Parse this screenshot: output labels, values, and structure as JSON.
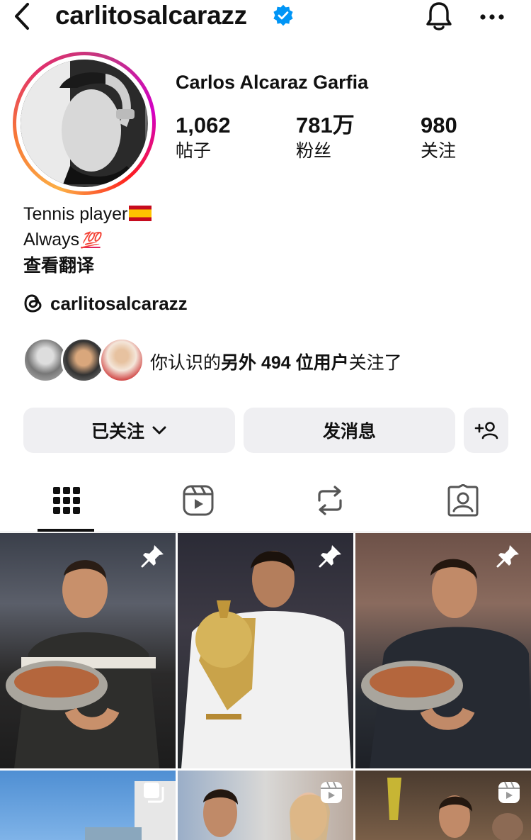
{
  "header": {
    "username": "carlitosalcarazz",
    "verified": true,
    "back_icon": "chevron-left-icon",
    "bell_icon": "bell-icon",
    "more_icon": "more-horizontal-icon"
  },
  "profile": {
    "full_name": "Carlos Alcaraz Garfia",
    "stats": [
      {
        "value": "1,062",
        "label": "帖子"
      },
      {
        "value": "781万",
        "label": "粉丝"
      },
      {
        "value": "980",
        "label": "关注"
      }
    ],
    "bio_line1": "Tennis player",
    "bio_line2": "Always",
    "bio_emoji2": "💯",
    "translate": "查看翻译",
    "threads_handle": "carlitosalcarazz"
  },
  "mutual": {
    "prefix": "你认识的",
    "bold": "另外 494 位用户",
    "suffix": "关注了"
  },
  "actions": {
    "following_label": "已关注",
    "message_label": "发消息",
    "add_person_icon": "add-person-icon"
  },
  "tabs": [
    {
      "name": "grid",
      "icon": "grid-icon",
      "active": true
    },
    {
      "name": "reels",
      "icon": "reels-icon",
      "active": false
    },
    {
      "name": "reposts",
      "icon": "repost-icon",
      "active": false
    },
    {
      "name": "tagged",
      "icon": "tagged-icon",
      "active": false
    }
  ],
  "colors": {
    "verified": "#0095f6",
    "button_bg": "#efeff2",
    "text": "#111111"
  }
}
